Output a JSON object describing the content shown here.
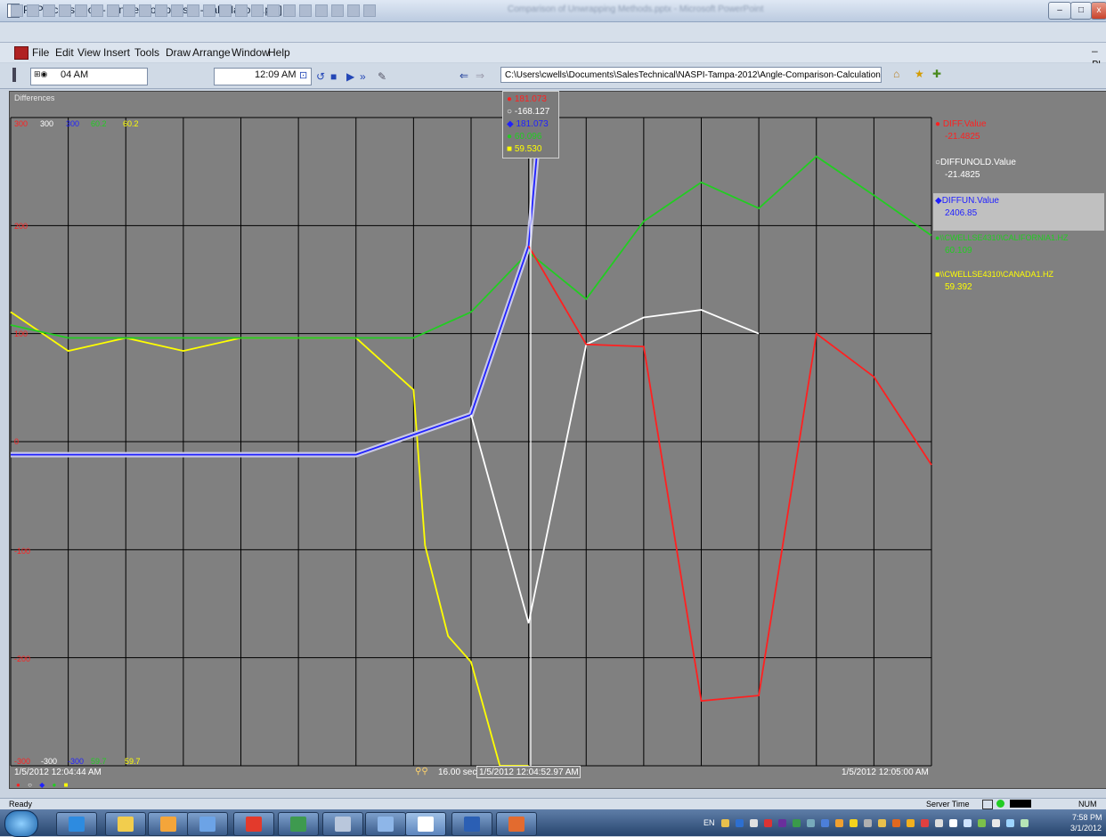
{
  "window": {
    "title": "PI ProcessBook - [Angle-Comparison-Calculations.pdi]",
    "background_title": "Comparison of Unwrapping Methods.pptx - Microsoft PowerPoint"
  },
  "title_buttons": {
    "minimize": "–",
    "maximize": "□",
    "close": "x"
  },
  "menu": [
    "File",
    "Edit",
    "View",
    "Insert",
    "Tools",
    "Draw",
    "Arrange",
    "Window",
    "Help"
  ],
  "mdi_restore": "– ₪",
  "nav": {
    "start_time": "04 AM",
    "end_time": "12:09 AM",
    "path": "C:\\Users\\cwells\\Documents\\SalesTechnical\\NASPI-Tampa-2012\\Angle-Comparison-Calculations.pdi"
  },
  "trend": {
    "title": "Differences",
    "top_scales": [
      {
        "text": "300",
        "color": "#ff2020"
      },
      {
        "text": "300",
        "color": "#ffffff"
      },
      {
        "text": "300",
        "color": "#2020ff"
      },
      {
        "text": "60.2",
        "color": "#22cc22"
      },
      {
        "text": "60.2",
        "color": "#ffff00"
      }
    ],
    "bottom_scales": [
      {
        "text": "-300",
        "color": "#ff2020"
      },
      {
        "text": "-300",
        "color": "#ffffff"
      },
      {
        "text": "-300",
        "color": "#2020ff"
      },
      {
        "text": "59.7",
        "color": "#22cc22"
      },
      {
        "text": "59.7",
        "color": "#ffff00"
      }
    ],
    "y_ticks": [
      "200",
      "100",
      "0",
      "-100",
      "-200"
    ],
    "time_start": "1/5/2012 12:04:44 AM",
    "time_end": "1/5/2012 12:05:00 AM",
    "time_span": "16.00 sec",
    "cursor_time": "1/5/2012 12:04:52.97 AM",
    "tooltip": [
      {
        "text": "181.073",
        "color": "#ff2020",
        "marker": "●"
      },
      {
        "text": "-168.127",
        "color": "#ffffff",
        "marker": "○"
      },
      {
        "text": "181.073",
        "color": "#2020ff",
        "marker": "◆"
      },
      {
        "text": "60.096",
        "color": "#22cc22",
        "marker": "●"
      },
      {
        "text": "59.530",
        "color": "#ffff00",
        "marker": "■"
      }
    ],
    "legend": [
      {
        "marker": "●",
        "name": "DIFF.Value",
        "value": "-21.4825",
        "color": "#ff2020"
      },
      {
        "marker": "○",
        "name": "DIFFUNOLD.Value",
        "value": "-21.4825",
        "color": "#ffffff"
      },
      {
        "marker": "◆",
        "name": "DIFFUN.Value",
        "value": "2406.85",
        "color": "#2020ff"
      },
      {
        "marker": "●",
        "name": "\\\\CWELLSE4310\\CALIFORNIA1.HZ",
        "value": "60.109",
        "color": "#22cc22"
      },
      {
        "marker": "■",
        "name": "\\\\CWELLSE4310\\CANADA1.HZ",
        "value": "59.392",
        "color": "#ffff00"
      }
    ],
    "marker_row": [
      {
        "m": "●",
        "color": "#ff2020"
      },
      {
        "m": "○",
        "color": "#ffffff"
      },
      {
        "m": "◆",
        "color": "#2020ff"
      },
      {
        "m": "●",
        "color": "#22cc22"
      },
      {
        "m": "■",
        "color": "#ffff00"
      }
    ]
  },
  "status": {
    "left": "Ready",
    "server_time": "Server Time",
    "num": "NUM"
  },
  "taskbar": {
    "lang": "EN",
    "time": "7:58 PM",
    "date": "3/1/2012"
  },
  "chart_data": {
    "type": "line",
    "xlabel": "",
    "ylabel": "",
    "x": [
      "12:04:44",
      "12:04:45",
      "12:04:46",
      "12:04:47",
      "12:04:48",
      "12:04:49",
      "12:04:50",
      "12:04:51",
      "12:04:52",
      "12:04:53",
      "12:04:54",
      "12:04:55",
      "12:04:56",
      "12:04:57",
      "12:04:58",
      "12:04:59",
      "12:05:00"
    ],
    "ylim": [
      -300,
      300
    ],
    "series": [
      {
        "name": "DIFF.Value",
        "color": "#ff2020",
        "x": [
          53,
          54,
          55,
          56,
          57,
          58,
          59,
          60
        ],
        "values": [
          181.073,
          90,
          88,
          -240,
          -235,
          100,
          60,
          -21.4825
        ]
      },
      {
        "name": "DIFFUNOLD.Value",
        "color": "#ffffff",
        "x": [
          52,
          53,
          54,
          55,
          56,
          57
        ],
        "values": [
          25,
          -168.127,
          90,
          115,
          122,
          100
        ]
      },
      {
        "name": "DIFFUN.Value",
        "color": "#2020ff",
        "x": [
          44,
          48,
          50,
          52,
          53,
          53.2
        ],
        "values": [
          -12,
          -12,
          -12,
          25,
          181.073,
          300
        ]
      },
      {
        "name": "\\\\CWELLSE4310\\CALIFORNIA1.HZ",
        "color": "#22cc22",
        "ylim": [
          59.7,
          60.2
        ],
        "x": [
          44,
          45,
          46,
          47,
          48,
          49,
          50,
          51,
          52,
          53,
          54,
          55,
          56,
          57,
          58,
          59,
          60
        ],
        "values": [
          60.04,
          60.03,
          60.03,
          60.03,
          60.03,
          60.03,
          60.03,
          60.03,
          60.05,
          60.096,
          60.06,
          60.12,
          60.15,
          60.13,
          60.17,
          60.14,
          60.109
        ]
      },
      {
        "name": "\\\\CWELLSE4310\\CANADA1.HZ",
        "color": "#ffff00",
        "ylim": [
          59.7,
          60.2
        ],
        "x": [
          44,
          45,
          46,
          47,
          48,
          49,
          50,
          51,
          51.2,
          51.6,
          52,
          52.5,
          53
        ],
        "values": [
          60.05,
          60.02,
          60.03,
          60.02,
          60.03,
          60.03,
          60.03,
          59.99,
          59.87,
          59.8,
          59.78,
          59.7,
          59.53
        ]
      }
    ]
  }
}
